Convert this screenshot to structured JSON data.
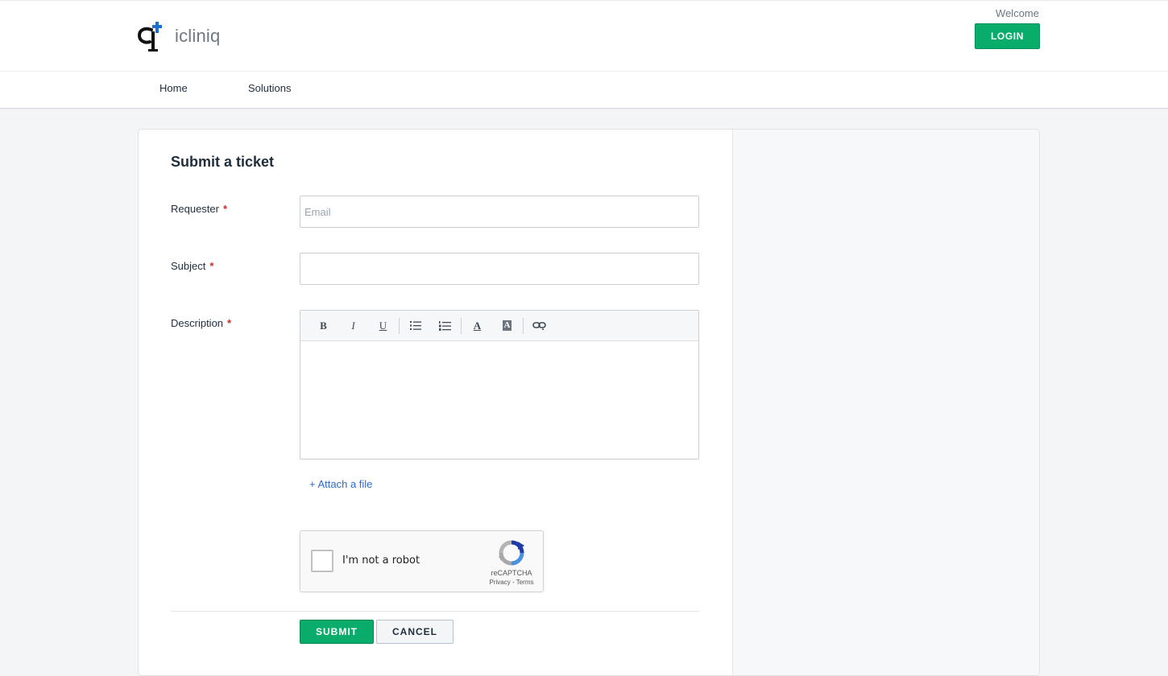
{
  "header": {
    "brand_name": "icliniq",
    "welcome_text": "Welcome",
    "login_label": "LOGIN"
  },
  "nav": {
    "items": [
      {
        "label": "Home"
      },
      {
        "label": "Solutions"
      }
    ]
  },
  "form": {
    "title": "Submit a ticket",
    "requester": {
      "label": "Requester",
      "placeholder": "Email",
      "value": ""
    },
    "subject": {
      "label": "Subject",
      "value": ""
    },
    "description": {
      "label": "Description"
    },
    "required_mark": "*",
    "attach_label": "+ Attach a file",
    "toolbar": {
      "bold": "B",
      "italic": "I",
      "underline": "U",
      "bullet_list_icon": "bullet-list-icon",
      "numbered_list_icon": "numbered-list-icon",
      "font_color": "A",
      "bg_color": "A",
      "link_icon": "link-icon"
    },
    "recaptcha": {
      "label": "I'm not a robot",
      "brand": "reCAPTCHA",
      "links": "Privacy - Terms"
    },
    "submit_label": "SUBMIT",
    "cancel_label": "CANCEL"
  },
  "colors": {
    "primary": "#0aac6c",
    "link": "#2c6ad2",
    "required": "#d12b2b"
  }
}
